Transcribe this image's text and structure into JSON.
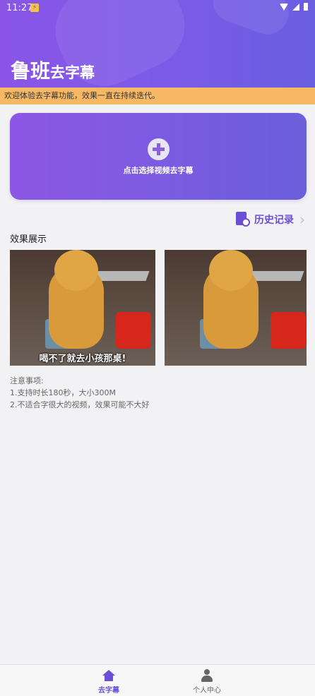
{
  "statusbar": {
    "time": "11:27"
  },
  "header": {
    "title_big": "鲁班",
    "title_small": "去字幕"
  },
  "notice": {
    "text": "欢迎体验去字幕功能，效果一直在持续迭代。"
  },
  "pick_card": {
    "label": "点击选择视频去字幕"
  },
  "history": {
    "label": "历史记录"
  },
  "demo": {
    "title": "效果展示",
    "caption": "喝不了就去小孩那桌!"
  },
  "notes": {
    "title": "注意事项:",
    "lines": [
      "1.支持时长180秒，大小300M",
      "2.不适合字很大的视频，效果可能不大好"
    ]
  },
  "nav": {
    "tab1": "去字幕",
    "tab2": "个人中心"
  },
  "colors": {
    "accent": "#6a4fd6",
    "notice_bg": "#f6b864",
    "header_start": "#8a55e6",
    "header_end": "#6a5fe0"
  },
  "icons": [
    "lightning-icon",
    "wifi-icon",
    "signal-icon",
    "battery-icon",
    "add-circle-icon",
    "history-icon",
    "chevron-right-icon",
    "home-icon",
    "person-icon"
  ]
}
